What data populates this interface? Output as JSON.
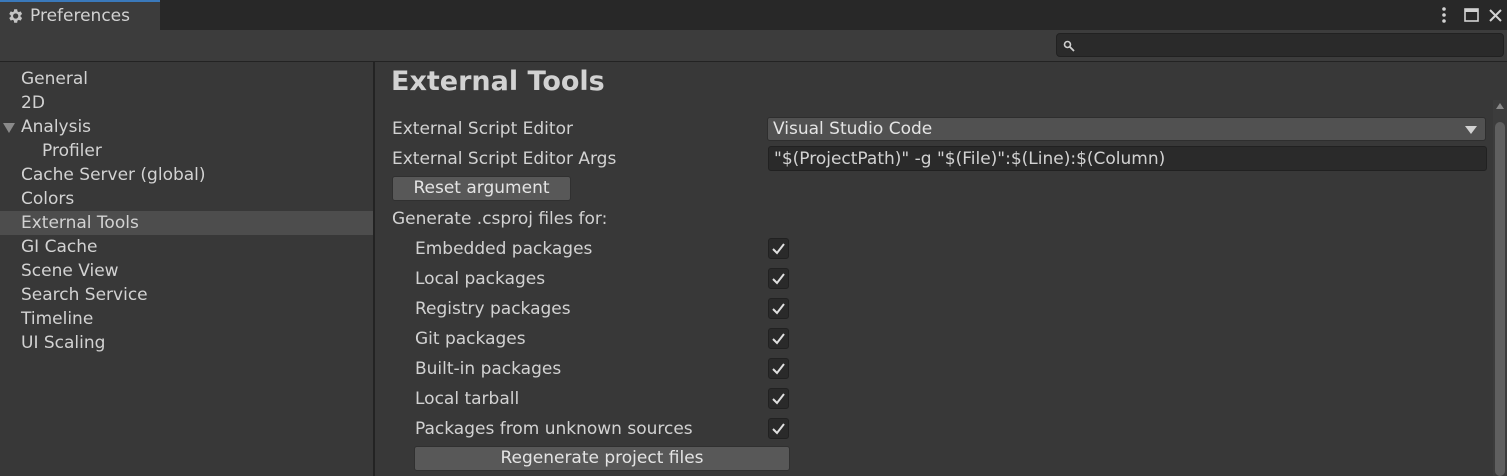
{
  "window": {
    "tab_title": "Preferences",
    "icons": {
      "tab": "gear-icon",
      "more": "kebab-menu-icon",
      "maximize": "maximize-icon",
      "close": "close-icon"
    }
  },
  "search": {
    "value": "",
    "placeholder": ""
  },
  "sidebar": {
    "items": [
      {
        "label": "General"
      },
      {
        "label": "2D"
      },
      {
        "label": "Analysis"
      },
      {
        "label": "Profiler"
      },
      {
        "label": "Cache Server (global)"
      },
      {
        "label": "Colors"
      },
      {
        "label": "External Tools"
      },
      {
        "label": "GI Cache"
      },
      {
        "label": "Scene View"
      },
      {
        "label": "Search Service"
      },
      {
        "label": "Timeline"
      },
      {
        "label": "UI Scaling"
      }
    ],
    "selected": "External Tools"
  },
  "main": {
    "title": "External Tools",
    "script_editor": {
      "label": "External Script Editor",
      "value": "Visual Studio Code"
    },
    "script_editor_args": {
      "label": "External Script Editor Args",
      "value": "\"$(ProjectPath)\" -g \"$(File)\":$(Line):$(Column)"
    },
    "reset_button": "Reset argument",
    "generate_label": "Generate .csproj files for:",
    "packages": [
      {
        "label": "Embedded packages",
        "checked": true
      },
      {
        "label": "Local packages",
        "checked": true
      },
      {
        "label": "Registry packages",
        "checked": true
      },
      {
        "label": "Git packages",
        "checked": true
      },
      {
        "label": "Built-in packages",
        "checked": true
      },
      {
        "label": "Local tarball",
        "checked": true
      },
      {
        "label": "Packages from unknown sources",
        "checked": true
      }
    ],
    "regenerate_button": "Regenerate project files"
  },
  "colors": {
    "background": "#383838",
    "tab_accent": "#3a79bb",
    "selected_row": "#4d4d4d",
    "text": "#d2d2d2"
  }
}
